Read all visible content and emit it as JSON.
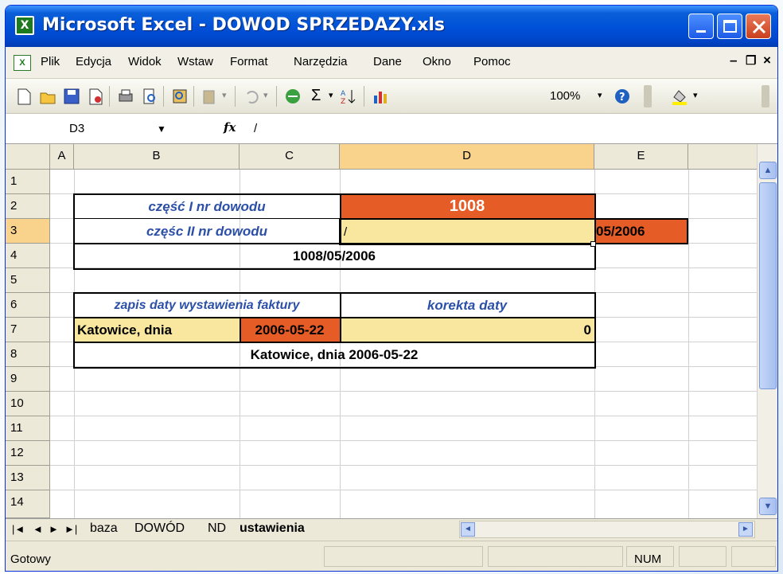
{
  "window": {
    "title": "Microsoft Excel - DOWOD SPRZEDAZY.xls",
    "app_icon_glyph": "X"
  },
  "menu": {
    "items": [
      "Plik",
      "Edycja",
      "Widok",
      "Wstaw",
      "Format",
      "Narzędzia",
      "Dane",
      "Okno",
      "Pomoc"
    ]
  },
  "toolbar": {
    "zoom": "100%"
  },
  "formula_bar": {
    "name_box": "D3",
    "fx": "fx",
    "value": "/"
  },
  "grid": {
    "columns": [
      "A",
      "B",
      "C",
      "D",
      "E"
    ],
    "rows": [
      "1",
      "2",
      "3",
      "4",
      "5",
      "6",
      "7",
      "8",
      "9",
      "10",
      "11",
      "12",
      "13",
      "14"
    ],
    "cells": {
      "b2": "część I nr dowodu",
      "d2": "1008",
      "b3": "częśc II nr dowodu",
      "d3": "/",
      "e3": "05/2006",
      "b4": "1008/05/2006",
      "b6": "zapis daty wystawienia faktury",
      "d6": "korekta daty",
      "b7": "Katowice, dnia",
      "c7": "2006-05-22",
      "d7": "0",
      "b8": "Katowice, dnia 2006-05-22"
    }
  },
  "sheets": {
    "tabs": [
      "baza",
      "DOWÓD",
      "ND",
      "ustawienia"
    ],
    "active": "ustawienia"
  },
  "status": {
    "text": "Gotowy",
    "num": "NUM"
  },
  "colors": {
    "orange": "#e65c27",
    "yellow": "#f9e79f",
    "label_blue": "#2c4fa8",
    "title_blue": "#0050d8"
  }
}
